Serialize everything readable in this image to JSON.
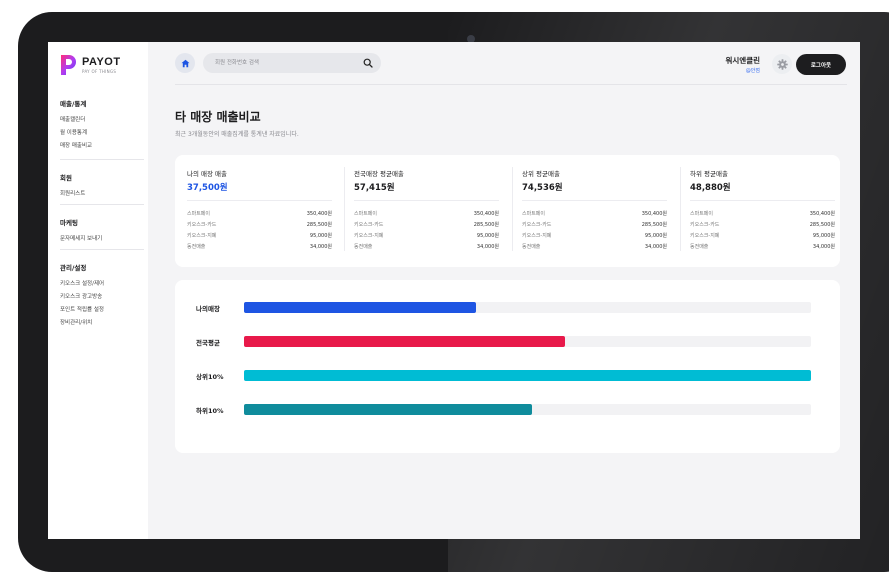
{
  "brand": {
    "name": "PAYOT",
    "tagline": "PAY OF THINGS"
  },
  "sidebar": {
    "sections": [
      {
        "title": "매출/통계",
        "items": [
          "매출캘린더",
          "월 이용통계",
          "매장 매출비교"
        ]
      },
      {
        "title": "회원",
        "items": [
          "회원리스트"
        ]
      },
      {
        "title": "마케팅",
        "items": [
          "문자메세지 보내기"
        ]
      },
      {
        "title": "관리/설정",
        "items": [
          "키오스크 설정/제어",
          "키오스크 광고방송",
          "포인트 적립률 설정",
          "장비관리/위치"
        ]
      }
    ]
  },
  "topbar": {
    "search_placeholder": "회원 전화번호 검색",
    "user_name": "워시엔클린",
    "user_branch": "@안점",
    "logout_label": "로그아웃"
  },
  "page": {
    "title": "타 매장 매출비교",
    "subtitle": "최근 3개월동안의 매출집계를 통계낸 자료입니다."
  },
  "stats": [
    {
      "label": "나의 매장 매출",
      "value": "37,500원",
      "rows": [
        {
          "name": "스마트페이",
          "amount": "350,400원"
        },
        {
          "name": "키오스크-카드",
          "amount": "285,500원"
        },
        {
          "name": "키오스크-지폐",
          "amount": "95,000원"
        },
        {
          "name": "동전매출",
          "amount": "34,000원"
        }
      ]
    },
    {
      "label": "전국매장 평균매출",
      "value": "57,415원",
      "rows": [
        {
          "name": "스마트페이",
          "amount": "350,400원"
        },
        {
          "name": "키오스크-카드",
          "amount": "285,500원"
        },
        {
          "name": "키오스크-지폐",
          "amount": "95,000원"
        },
        {
          "name": "동전매출",
          "amount": "34,000원"
        }
      ]
    },
    {
      "label": "상위 평균매출",
      "value": "74,536원",
      "rows": [
        {
          "name": "스마트페이",
          "amount": "350,400원"
        },
        {
          "name": "키오스크-카드",
          "amount": "285,500원"
        },
        {
          "name": "키오스크-지폐",
          "amount": "95,000원"
        },
        {
          "name": "동전매출",
          "amount": "34,000원"
        }
      ]
    },
    {
      "label": "하위 평균매출",
      "value": "48,880원",
      "rows": [
        {
          "name": "스마트페이",
          "amount": "350,400원"
        },
        {
          "name": "키오스크-카드",
          "amount": "285,500원"
        },
        {
          "name": "키오스크-지폐",
          "amount": "95,000원"
        },
        {
          "name": "동전매출",
          "amount": "34,000원"
        }
      ]
    }
  ],
  "comparison": [
    {
      "label": "나의매장",
      "fraction": 0.41,
      "color": "#1e55e3"
    },
    {
      "label": "전국평균",
      "fraction": 0.566,
      "color": "#e8194a"
    },
    {
      "label": "상위10%",
      "fraction": 1.0,
      "color": "#00bcd4"
    },
    {
      "label": "하위10%",
      "fraction": 0.508,
      "color": "#0f8c9c"
    }
  ],
  "colors": {
    "accent": "#1e55e3",
    "dark_button": "#1d1d1f",
    "screen_bg": "#f4f4f6"
  },
  "icons": {
    "home": "home-icon",
    "search": "search-icon",
    "settings": "gear-icon"
  }
}
